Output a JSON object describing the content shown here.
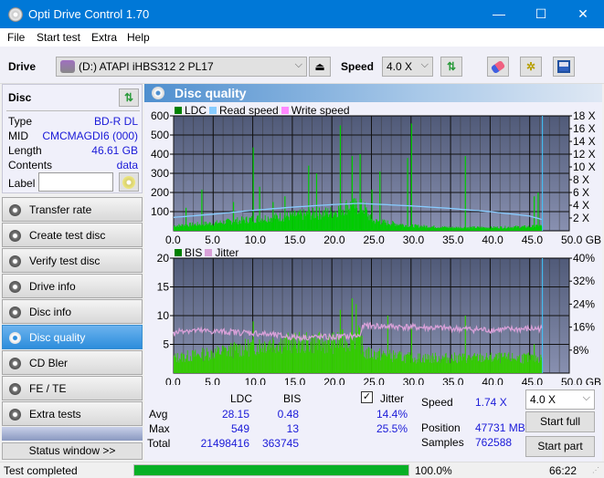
{
  "window": {
    "title": "Opti Drive Control 1.70",
    "minimize": "—",
    "maximize": "☐",
    "close": "✕"
  },
  "menu": [
    "File",
    "Start test",
    "Extra",
    "Help"
  ],
  "toolbar": {
    "drive_label": "Drive",
    "drive_value": "(D:)  ATAPI iHBS312  2 PL17",
    "speed_label": "Speed",
    "speed_value": "4.0 X"
  },
  "disc": {
    "header": "Disc",
    "rows": [
      {
        "label": "Type",
        "value": "BD-R DL"
      },
      {
        "label": "MID",
        "value": "CMCMAGDI6 (000)"
      },
      {
        "label": "Length",
        "value": "46.61 GB"
      },
      {
        "label": "Contents",
        "value": "data"
      }
    ],
    "label_field": "Label",
    "label_value": ""
  },
  "nav": [
    {
      "label": "Transfer rate",
      "active": false
    },
    {
      "label": "Create test disc",
      "active": false
    },
    {
      "label": "Verify test disc",
      "active": false
    },
    {
      "label": "Drive info",
      "active": false
    },
    {
      "label": "Disc info",
      "active": false
    },
    {
      "label": "Disc quality",
      "active": true
    },
    {
      "label": "CD Bler",
      "active": false
    },
    {
      "label": "FE / TE",
      "active": false
    },
    {
      "label": "Extra tests",
      "active": false
    }
  ],
  "status_window_button": "Status window >>",
  "panel_title": "Disc quality",
  "colors": {
    "ldc": "#008000",
    "ldc_fill": "#00cc00",
    "read_speed": "#88ccff",
    "write_speed": "#ff88ff",
    "bis": "#008000",
    "jitter": "#d8a0d8",
    "plot_bg_top": "#505a78",
    "plot_bg_bottom": "#8890b0",
    "accent": "#0078d7",
    "progress": "#06b025"
  },
  "chart_data": [
    {
      "type": "bar",
      "title": "LDC / Read speed",
      "legend": [
        "LDC",
        "Read speed",
        "Write speed"
      ],
      "xlabel": "GB",
      "x_ticks": [
        "0.0",
        "5.0",
        "10.0",
        "15.0",
        "20.0",
        "25.0",
        "30.0",
        "35.0",
        "40.0",
        "45.0",
        "50.0 GB"
      ],
      "y_ticks_left": [
        "100",
        "200",
        "300",
        "400",
        "500",
        "600"
      ],
      "y_ticks_right": [
        "2 X",
        "4 X",
        "6 X",
        "8 X",
        "10 X",
        "12 X",
        "14 X",
        "16 X",
        "18 X"
      ],
      "xlim": [
        0,
        50
      ],
      "ylim": [
        0,
        600
      ],
      "y2lim": [
        0,
        18
      ],
      "disc_end_gb": 46.61,
      "ldc_baseline": [
        [
          0,
          30
        ],
        [
          5,
          45
        ],
        [
          10,
          70
        ],
        [
          15,
          90
        ],
        [
          20,
          110
        ],
        [
          22,
          150
        ],
        [
          24,
          140
        ],
        [
          25,
          60
        ],
        [
          30,
          30
        ],
        [
          35,
          20
        ],
        [
          40,
          20
        ],
        [
          45,
          25
        ],
        [
          46.6,
          30
        ]
      ],
      "ldc_spikes": [
        [
          1.5,
          120
        ],
        [
          3.5,
          215
        ],
        [
          7.5,
          150
        ],
        [
          10,
          435
        ],
        [
          10.8,
          230
        ],
        [
          12.5,
          150
        ],
        [
          14,
          180
        ],
        [
          17,
          340
        ],
        [
          18,
          300
        ],
        [
          21,
          550
        ],
        [
          22.5,
          390
        ],
        [
          23.5,
          400
        ],
        [
          25,
          215
        ],
        [
          26,
          310
        ],
        [
          29.5,
          380
        ],
        [
          30,
          560
        ],
        [
          36.8,
          390
        ],
        [
          45.5,
          180
        ],
        [
          46,
          200
        ]
      ],
      "read_speed": [
        [
          0,
          2.1
        ],
        [
          5,
          2.6
        ],
        [
          10,
          3.2
        ],
        [
          15,
          3.7
        ],
        [
          20,
          4.1
        ],
        [
          23.5,
          4.3
        ],
        [
          25,
          4.2
        ],
        [
          30,
          3.9
        ],
        [
          35,
          3.5
        ],
        [
          40,
          3.0
        ],
        [
          45,
          2.3
        ],
        [
          46.61,
          1.74
        ]
      ]
    },
    {
      "type": "bar",
      "title": "BIS / Jitter",
      "legend": [
        "BIS",
        "Jitter"
      ],
      "xlabel": "GB",
      "x_ticks": [
        "0.0",
        "5.0",
        "10.0",
        "15.0",
        "20.0",
        "25.0",
        "30.0",
        "35.0",
        "40.0",
        "45.0",
        "50.0 GB"
      ],
      "y_ticks_left": [
        "5",
        "10",
        "15",
        "20"
      ],
      "y_ticks_right": [
        "8%",
        "16%",
        "24%",
        "32%",
        "40%"
      ],
      "xlim": [
        0,
        50
      ],
      "ylim": [
        0,
        20
      ],
      "y2lim": [
        0,
        40
      ],
      "bis_baseline": [
        [
          0,
          3
        ],
        [
          5,
          4
        ],
        [
          9,
          5
        ],
        [
          12,
          6
        ],
        [
          15,
          6
        ],
        [
          20,
          6
        ],
        [
          23.5,
          7
        ],
        [
          24,
          4
        ],
        [
          30,
          3
        ],
        [
          40,
          3
        ],
        [
          46.6,
          3
        ]
      ],
      "bis_spikes": [
        [
          10,
          9
        ],
        [
          21,
          11
        ],
        [
          22.5,
          13
        ],
        [
          23,
          12
        ],
        [
          27,
          10
        ],
        [
          30,
          8
        ],
        [
          36.8,
          10
        ],
        [
          45.5,
          5
        ]
      ],
      "jitter": [
        [
          0,
          13.5
        ],
        [
          1,
          15
        ],
        [
          5,
          14.5
        ],
        [
          10,
          14
        ],
        [
          15,
          12.5
        ],
        [
          20,
          12.5
        ],
        [
          23.5,
          13
        ],
        [
          24,
          16.5
        ],
        [
          30,
          16
        ],
        [
          35,
          15.5
        ],
        [
          40,
          15
        ],
        [
          46.61,
          15.5
        ]
      ]
    }
  ],
  "stats": {
    "col_ldc": "LDC",
    "col_bis": "BIS",
    "rows": [
      {
        "label": "Avg",
        "ldc": "28.15",
        "bis": "0.48",
        "jitter": "14.4%"
      },
      {
        "label": "Max",
        "ldc": "549",
        "bis": "13",
        "jitter": "25.5%"
      },
      {
        "label": "Total",
        "ldc": "21498416",
        "bis": "363745"
      }
    ],
    "jitter_label": "Jitter",
    "jitter_checked": true,
    "speed_label": "Speed",
    "speed_value": "1.74 X",
    "position_label": "Position",
    "position_value": "47731 MB",
    "samples_label": "Samples",
    "samples_value": "762588",
    "speed_select": "4.0 X",
    "start_full": "Start full",
    "start_part": "Start part"
  },
  "status": {
    "text": "Test completed",
    "progress_percent": 100.0,
    "progress_label": "100.0%",
    "elapsed": "66:22"
  }
}
